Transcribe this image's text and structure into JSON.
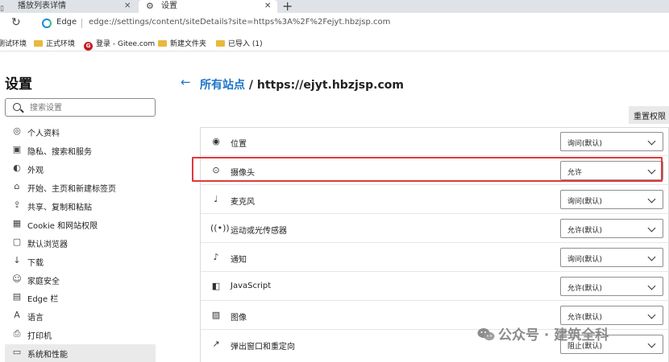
{
  "tabs": [
    {
      "label": "播放列表详情",
      "icon": "page-icon"
    },
    {
      "label": "设置",
      "icon": "gear-icon",
      "active": true
    }
  ],
  "address_bar": {
    "browser_name": "Edge",
    "url": "edge://settings/content/siteDetails?site=https%3A%2F%2Fejyt.hbzjsp.com"
  },
  "bookmarks": [
    {
      "label": "测试环境",
      "icon": "folder-icon"
    },
    {
      "label": "正式环境",
      "icon": "folder-icon"
    },
    {
      "label": "登录 - Gitee.com",
      "icon": "gitee-icon"
    },
    {
      "label": "新建文件夹",
      "icon": "folder-icon"
    },
    {
      "label": "已导入 (1)",
      "icon": "folder-icon"
    }
  ],
  "sidebar": {
    "title": "设置",
    "search_placeholder": "搜索设置",
    "items": [
      {
        "label": "个人资料",
        "icon": "profile-icon"
      },
      {
        "label": "隐私、搜索和服务",
        "icon": "lock-icon"
      },
      {
        "label": "外观",
        "icon": "appearance-icon"
      },
      {
        "label": "开始、主页和新建标签页",
        "icon": "home-icon"
      },
      {
        "label": "共享、复制和粘贴",
        "icon": "share-icon"
      },
      {
        "label": "Cookie 和网站权限",
        "icon": "cookie-icon"
      },
      {
        "label": "默认浏览器",
        "icon": "browser-icon"
      },
      {
        "label": "下载",
        "icon": "download-icon"
      },
      {
        "label": "家庭安全",
        "icon": "family-icon"
      },
      {
        "label": "Edge 栏",
        "icon": "edge-bar-icon"
      },
      {
        "label": "语言",
        "icon": "language-icon"
      },
      {
        "label": "打印机",
        "icon": "printer-icon"
      },
      {
        "label": "系统和性能",
        "icon": "system-icon",
        "active": true
      }
    ]
  },
  "main": {
    "breadcrumb_link": "所有站点",
    "breadcrumb_separator": " / ",
    "breadcrumb_current": "https://ejyt.hbzjsp.com",
    "reset_button": "重置权限",
    "permissions": [
      {
        "label": "位置",
        "icon": "location-icon",
        "value": "询问(默认)"
      },
      {
        "label": "摄像头",
        "icon": "camera-icon",
        "value": "允许",
        "highlighted": true
      },
      {
        "label": "麦克风",
        "icon": "microphone-icon",
        "value": "询问(默认)"
      },
      {
        "label": "运动或光传感器",
        "icon": "sensor-icon",
        "value": "允许(默认)"
      },
      {
        "label": "通知",
        "icon": "bell-icon",
        "value": "询问(默认)"
      },
      {
        "label": "JavaScript",
        "icon": "javascript-icon",
        "value": "允许(默认)"
      },
      {
        "label": "图像",
        "icon": "image-icon",
        "value": "允许(默认)"
      },
      {
        "label": "弹出窗口和重定向",
        "icon": "popup-icon",
        "value": "阻止(默认)"
      }
    ]
  },
  "watermark": {
    "text": "公众号 · 建筑全科"
  },
  "colors": {
    "accent": "#1a73c8",
    "highlight": "#e0393b",
    "active_nav": "#eaeaea"
  }
}
